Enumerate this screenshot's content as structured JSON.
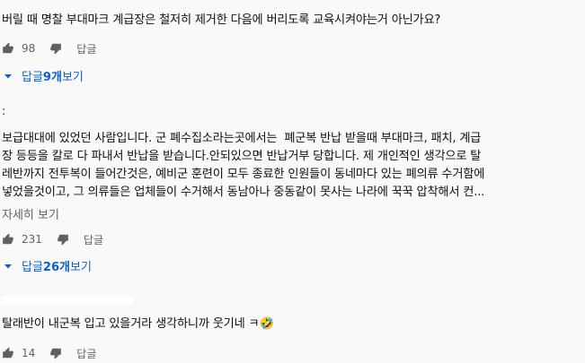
{
  "comments": [
    {
      "lines": [
        "버릴 때 명찰 부대마크 계급장은 철저히 제거한 다음에 버리도록 교육시켜야는거 아닌가요?"
      ],
      "likes": "98",
      "reply_label": "답글",
      "replies_prefix": "답글 ",
      "replies_count": "9개",
      "replies_suffix": " 보기"
    },
    {
      "author": ":",
      "lines": [
        "보급대대에 있었던 사람입니다. 군 폐수집소라는곳에서는  폐군복 반납 받을때 부대마크, 패치, 계급",
        "장 등등을 칼로 다 파내서 반납을 받습니다.안되있으면 반납거부 당합니다. 제 개인적인 생각으로 탈",
        "레반까지 전투복이 들어간것은, 예비군 훈련이 모두 종료한 인원들이 동네마다 있는 폐의류 수거함에",
        "넣었을것이고, 그 의류들은 업체들이 수거해서 동남아나 중동같이 못사는 나라에 꾹꾹 압착해서 컨..."
      ],
      "more_label": "자세히 보기",
      "likes": "231",
      "reply_label": "답글",
      "replies_prefix": "답글 ",
      "replies_count": "26개",
      "replies_suffix": " 보기"
    },
    {
      "lines": [
        "탈래반이 내군복 입고 있을거라 생각하니까 웃기네 ㅋ🤣"
      ],
      "likes": "14",
      "reply_label": "답글"
    }
  ],
  "colors": {
    "link": "#065fd4",
    "meta": "#606060",
    "background": "#f9f9f9"
  },
  "icons": [
    "thumb-up-icon",
    "thumb-down-icon",
    "caret-down-icon"
  ]
}
